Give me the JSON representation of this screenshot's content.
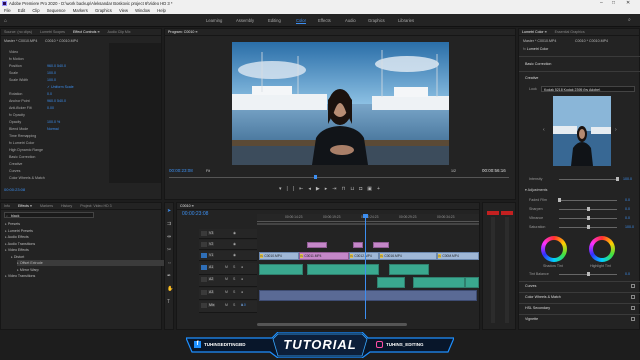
{
  "titlebar": {
    "title": "Adobe Premiere Pro 2020 - D:\\work backup\\Aleksandar Boskovic project 6\\Video HD 3 *",
    "controls": [
      "–",
      "□",
      "✕"
    ]
  },
  "menubar": {
    "items": [
      "File",
      "Edit",
      "Clip",
      "Sequence",
      "Markers",
      "Graphics",
      "View",
      "Window",
      "Help"
    ]
  },
  "workspaces": {
    "items": [
      "Learning",
      "Assembly",
      "Editing",
      "Color",
      "Effects",
      "Audio",
      "Graphics",
      "Libraries"
    ],
    "active": "Color"
  },
  "source_panel": {
    "tabs": [
      "Source: (no clips)",
      "Lumetri Scopes",
      "Effect Controls ≡",
      "Audio Clip Mix"
    ],
    "master": "Master * C0010.MP4",
    "clip_name": "C0010.MP4",
    "sequence": "C0010 * C0010.MP4",
    "rows": [
      {
        "label": "Video",
        "value": ""
      },
      {
        "label": "fx Motion",
        "value": ""
      },
      {
        "label": "Position",
        "value": "960.0   540.0"
      },
      {
        "label": "Scale",
        "value": "100.0"
      },
      {
        "label": "Scale Width",
        "value": "100.0"
      },
      {
        "label": "",
        "value": "✓ Uniform Scale"
      },
      {
        "label": "Rotation",
        "value": "0.0"
      },
      {
        "label": "Anchor Point",
        "value": "960.0   540.0"
      },
      {
        "label": "Anti-flicker Filt",
        "value": "0.00"
      },
      {
        "label": "fx Opacity",
        "value": ""
      },
      {
        "label": "Opacity",
        "value": "100.0 %"
      },
      {
        "label": "Blend Mode",
        "value": "Normal"
      },
      {
        "label": "Time Remapping",
        "value": ""
      },
      {
        "label": "fx Lumetri Color",
        "value": ""
      },
      {
        "label": "High Dynamic Range",
        "value": ""
      },
      {
        "label": "Basic Correction",
        "value": ""
      },
      {
        "label": "Creative",
        "value": ""
      },
      {
        "label": "Curves",
        "value": ""
      },
      {
        "label": "Color Wheels & Match",
        "value": ""
      }
    ],
    "timecode": "00:00:23:08"
  },
  "program": {
    "title": "Program: C0010 ≡",
    "timecode": "00:00:23:08",
    "fit": "Fit",
    "quality": "1/2",
    "duration": "00:00:56:16"
  },
  "effects_panel": {
    "tabs": [
      "Info",
      "Effects ≡",
      "Markers",
      "History",
      "Project: Video HD 3"
    ],
    "search": "black",
    "tree": [
      "Presets",
      "Lumetri Presets",
      "Audio Effects",
      "Audio Transitions",
      "Video Effects",
      "Distort",
      "Offset Extrude",
      "Mirror Warp",
      "Video Transitions"
    ]
  },
  "timeline": {
    "sequence": "C0010 ≡",
    "timecode": "00:00:23:08",
    "ruler": [
      "00:00:14:23",
      "00:00:19:23",
      "00:00:24:23",
      "00:00:29:23",
      "00:00:34:23"
    ],
    "tracks": [
      "V3",
      "V2",
      "V1",
      "A1",
      "A2",
      "A3",
      "Mix"
    ],
    "mix_value": "0.0",
    "clips_v1": [
      "C0010.MP4",
      "C0011.MP4",
      "C0012.MP4",
      "C0016.MP4",
      "C00M.MP4"
    ]
  },
  "lumetri": {
    "tabs": [
      "Lumetri Color ≡",
      "Essential Graphics"
    ],
    "master": "Master * C0010.MP4",
    "sequence": "C0010 * C0010.MP4",
    "fx": "Lumetri Color",
    "basic_correction": "Basic Correction",
    "creative": "Creative",
    "look_label": "Look",
    "look_value": "Kodak 5218 Kodak 2395 (by Adobe)",
    "intensity": {
      "label": "Intensity",
      "value": "100.0",
      "level": 1.0
    },
    "adjustments": "Adjustments",
    "sliders": [
      {
        "label": "Faded Film",
        "value": "0.0",
        "level": 0.0
      },
      {
        "label": "Sharpen",
        "value": "0.0",
        "level": 0.5
      },
      {
        "label": "Vibrance",
        "value": "0.0",
        "level": 0.5
      },
      {
        "label": "Saturation",
        "value": "100.0",
        "level": 0.5
      }
    ],
    "shadow_tint": "Shadow Tint",
    "highlight_tint": "Highlight Tint",
    "tint_balance": {
      "label": "Tint Balance",
      "value": "0.0"
    },
    "sections": [
      "Curves",
      "Color Wheels & Match",
      "HSL Secondary",
      "Vignette"
    ]
  },
  "banner": {
    "left_handle": "TUHINSEDITINGBD",
    "center": "TUTORIAL",
    "right_handle": "TUHINS_EDITING"
  },
  "colors": {
    "accent": "#3d8ef0",
    "clip_audio": "#3aa88f",
    "clip_video": "#9fb7d6",
    "clip_pink": "#c487c8"
  }
}
